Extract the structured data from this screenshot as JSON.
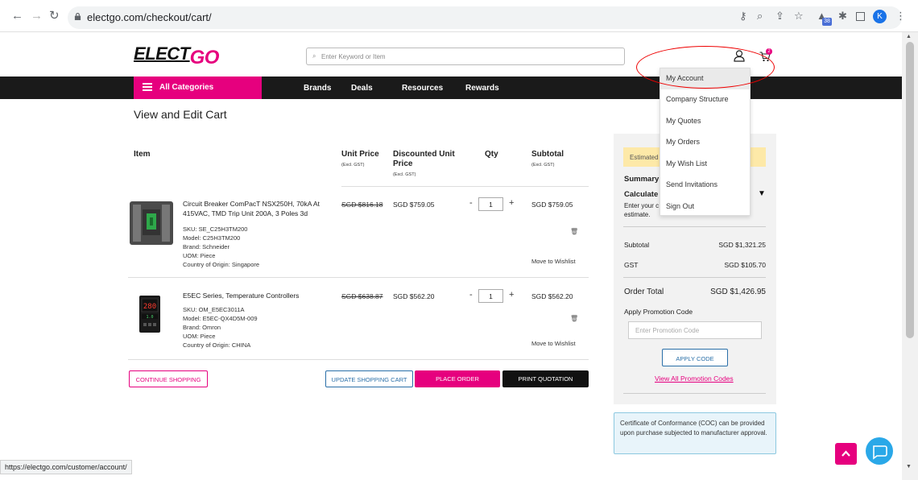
{
  "browser": {
    "url": "electgo.com/checkout/cart/",
    "profile_initial": "K",
    "extension_badge": "38"
  },
  "header": {
    "logo_main": "ELECT",
    "logo_accent": "GO",
    "search_placeholder": "Enter Keyword or Item",
    "cart_count": "2"
  },
  "nav": {
    "all_categories": "All Categories",
    "links": [
      "Brands",
      "Deals",
      "Resources",
      "Rewards"
    ]
  },
  "account_menu": {
    "items": [
      "My Account",
      "Company Structure",
      "My Quotes",
      "My Orders",
      "My Wish List",
      "Send Invitations",
      "Sign Out"
    ],
    "highlighted_index": 0
  },
  "cart": {
    "title": "View and Edit Cart",
    "columns": {
      "item": "Item",
      "unit_price": "Unit Price",
      "unit_price_sub": "(Excl. GST)",
      "discounted_line1": "Discounted Unit",
      "discounted_line2": "Price",
      "discounted_sub": "(Excl. GST)",
      "qty": "Qty",
      "subtotal": "Subtotal",
      "subtotal_sub": "(Excl. GST)"
    },
    "items": [
      {
        "name_line1": "Circuit Breaker ComPacT NSX250H, 70kA At",
        "name_line2": "415VAC, TMD Trip Unit 200A, 3 Poles 3d",
        "sku": "SKU:  SE_C25H3TM200",
        "model": "Model:  C25H3TM200",
        "brand": "Brand:  Schneider",
        "uom": "UOM:  Piece",
        "origin": "Country of Origin:  Singapore",
        "original_price": "SGD $816.18",
        "discounted_price": "SGD $759.05",
        "qty": "1",
        "subtotal": "SGD $759.05",
        "wishlist": "Move to Wishlist"
      },
      {
        "name_line1": "E5EC Series, Temperature Controllers",
        "sku": "SKU:  OM_E5EC3011A",
        "model": "Model:  E5EC-QX4D5M-009",
        "brand": "Brand:  Omron",
        "uom": "UOM:  Piece",
        "origin": "Country of Origin:  CHINA",
        "original_price": "SGD $638.87",
        "discounted_price": "SGD $562.20",
        "qty": "1",
        "subtotal": "SGD $562.20",
        "wishlist": "Move to Wishlist"
      }
    ],
    "qty_minus": "-",
    "qty_plus": "+",
    "buttons": {
      "continue": "CONTINUE SHOPPING",
      "update": "UPDATE SHOPPING CART",
      "place": "PLACE ORDER",
      "print": "PRINT QUOTATION"
    }
  },
  "summary": {
    "estimated_banner": "Estimated",
    "summary_heading": "Summary",
    "calculate_heading": "Calculate",
    "enter_text_line1": "Enter your c",
    "enter_text_line2": "estimate.",
    "subtotal_label": "Subtotal",
    "subtotal_value": "SGD $1,321.25",
    "gst_label": "GST",
    "gst_value": "SGD $105.70",
    "total_label": "Order Total",
    "total_value": "SGD $1,426.95",
    "promo_heading": "Apply Promotion Code",
    "promo_placeholder": "Enter Promotion Code",
    "apply_button": "APPLY CODE",
    "view_all_link": "View All Promotion Codes"
  },
  "coc_note": "Certificate of Conformance (COC) can be provided upon purchase subjected to manufacturer approval.",
  "status_bar": "https://electgo.com/customer/account/",
  "colors": {
    "brand_pink": "#e6007e",
    "nav_dark": "#1a1a1a",
    "annotation_red": "#e00000"
  }
}
